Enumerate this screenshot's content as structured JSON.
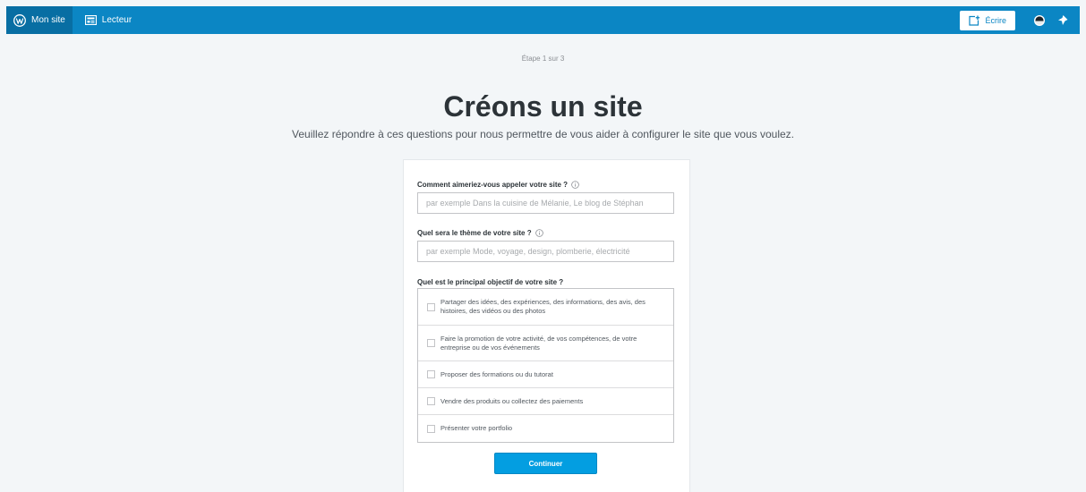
{
  "masterbar": {
    "my_site_label": "Mon site",
    "reader_label": "Lecteur",
    "write_label": "Écrire",
    "icons": [
      "wordpress-icon",
      "reader-icon",
      "write-icon",
      "avatar-icon",
      "notifications-icon"
    ],
    "colors": {
      "bar": "#0b86c4",
      "active": "#086ea3"
    }
  },
  "onboarding": {
    "step": "Étape 1 sur 3",
    "title": "Créons un site",
    "subtitle": "Veuillez répondre à ces questions pour nous permettre de vous aider à configurer le site que vous voulez."
  },
  "form": {
    "site_name_label": "Comment aimeriez-vous appeler votre site ?",
    "site_name_placeholder": "par exemple Dans la cuisine de Mélanie, Le blog de Stéphan",
    "site_name_value": "",
    "topic_label": "Quel sera le thème de votre site ?",
    "topic_placeholder": "par exemple Mode, voyage, design, plomberie, électricité",
    "topic_value": "",
    "goal_label": "Quel est le principal objectif de votre site ?",
    "goals": [
      {
        "label": "Partager des idées, des expériences, des informations, des avis, des histoires, des vidéos ou des photos",
        "checked": false
      },
      {
        "label": "Faire la promotion de votre activité, de vos compétences, de votre entreprise ou de vos événements",
        "checked": false
      },
      {
        "label": "Proposer des formations ou du tutorat",
        "checked": false
      },
      {
        "label": "Vendre des produits ou collectez des paiements",
        "checked": false
      },
      {
        "label": "Présenter votre portfolio",
        "checked": false
      }
    ],
    "continue_label": "Continuer",
    "accent": "#039ee1"
  }
}
